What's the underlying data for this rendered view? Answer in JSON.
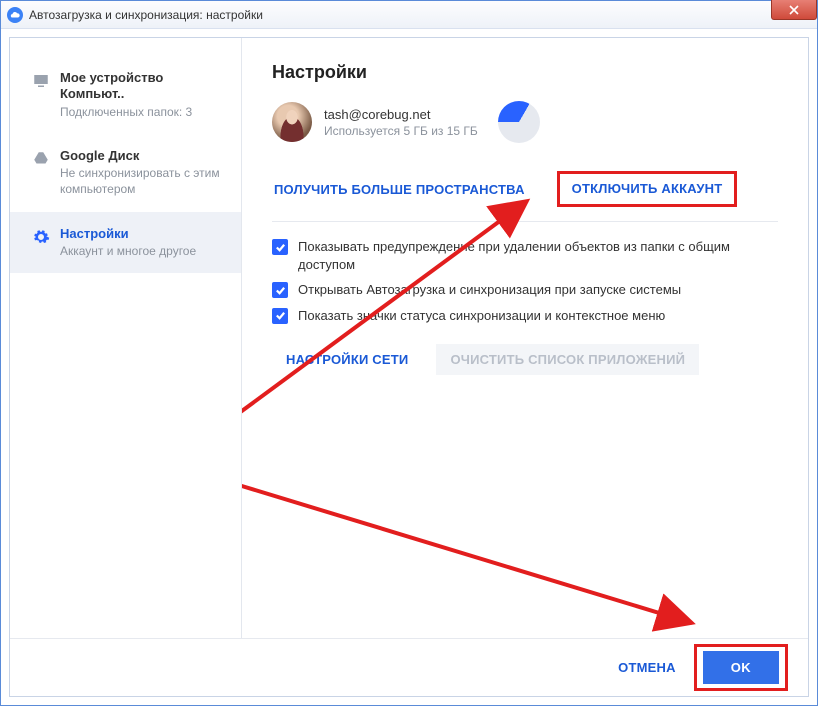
{
  "window": {
    "title": "Автозагрузка и синхронизация: настройки"
  },
  "sidebar": {
    "items": [
      {
        "title": "Мое устройство Компьют..",
        "sub": "Подключенных папок: 3"
      },
      {
        "title": "Google Диск",
        "sub": "Не синхронизировать с этим компьютером"
      },
      {
        "title": "Настройки",
        "sub": "Аккаунт и многое другое"
      }
    ]
  },
  "main": {
    "heading": "Настройки",
    "account": {
      "email": "tash@corebug.net",
      "usage": "Используется 5 ГБ из 15 ГБ"
    },
    "links": {
      "more_space": "ПОЛУЧИТЬ БОЛЬШЕ ПРОСТРАНСТВА",
      "disconnect": "ОТКЛЮЧИТЬ АККАУНТ"
    },
    "checks": [
      "Показывать предупреждение при удалении объектов из папки с общим доступом",
      "Открывать Автозагрузка и синхронизация при запуске системы",
      "Показать значки статуса синхронизации и контекстное меню"
    ],
    "buttons": {
      "net": "НАСТРОЙКИ СЕТИ",
      "clear": "ОЧИСТИТЬ СПИСОК ПРИЛОЖЕНИЙ"
    }
  },
  "footer": {
    "cancel": "ОТМЕНА",
    "ok": "OK"
  },
  "colors": {
    "accent": "#2962ff",
    "annotate": "#e21e1e"
  }
}
